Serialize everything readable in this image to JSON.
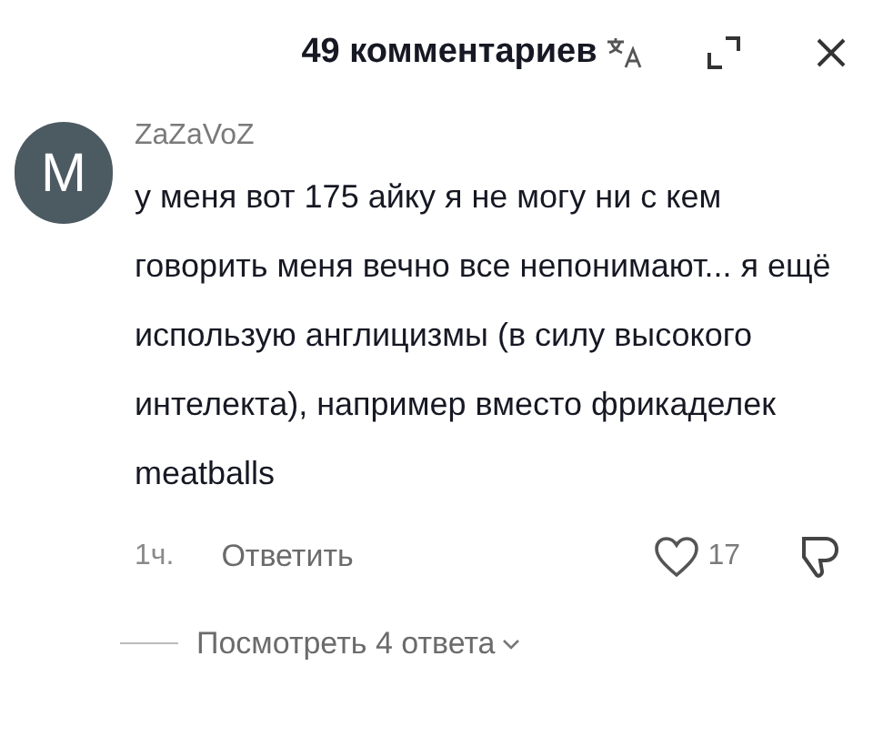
{
  "header": {
    "title": "49 комментариев"
  },
  "comment": {
    "avatar_letter": "M",
    "author": "ZaZaVoZ",
    "text": "у меня вот 175 айку я не могу ни с кем говорить меня вечно все непонимают... я ещё использую англицизмы (в силу высокого интелекта), например вместо фрикаделек meatballs",
    "time": "1ч.",
    "reply": "Ответить",
    "likes": "17",
    "view_replies": "Посмотреть 4 ответа"
  }
}
